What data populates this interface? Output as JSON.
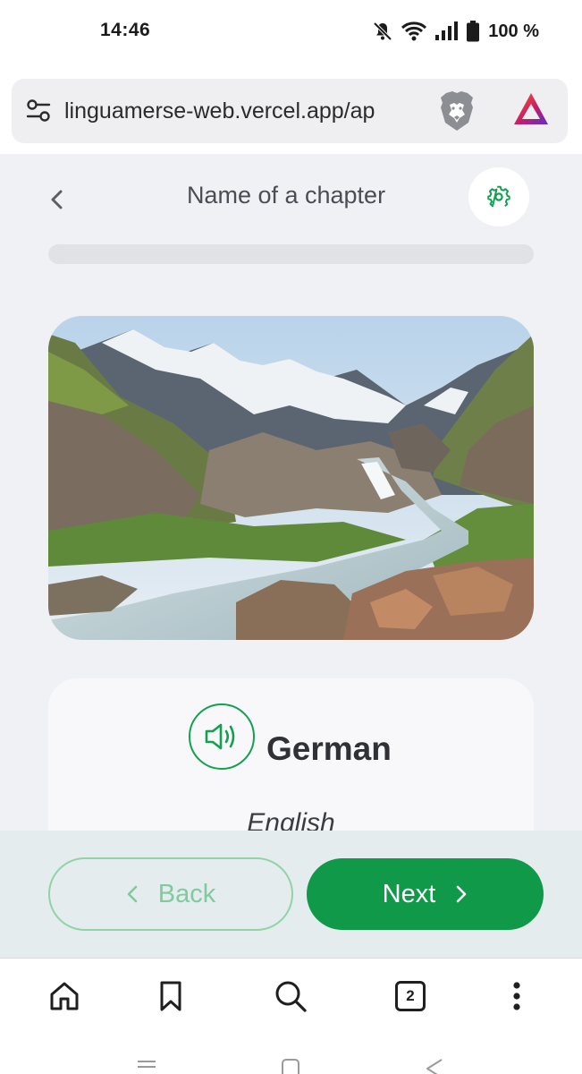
{
  "status_bar": {
    "time": "14:46",
    "battery": "100 %",
    "icons": [
      "bell-off-icon",
      "wifi-icon",
      "signal-icon",
      "battery-icon"
    ]
  },
  "browser": {
    "url": "linguamerse-web.vercel.app/ap",
    "icons": [
      "tune-icon",
      "brave-shield-icon",
      "brave-rewards-icon"
    ]
  },
  "header": {
    "title": "Name of a chapter",
    "progress": 0
  },
  "card": {
    "word": "German",
    "translation": "English"
  },
  "actions": {
    "back_label": "Back",
    "next_label": "Next"
  },
  "toolbar": {
    "tab_count": "2",
    "icons": [
      "home-icon",
      "bookmark-icon",
      "search-icon",
      "tabs-icon",
      "more-icon"
    ]
  },
  "colors": {
    "accent": "#12a150",
    "accent_light": "#8fd3a9",
    "background": "#f0f1f5",
    "action_bar": "#e5ecee"
  }
}
